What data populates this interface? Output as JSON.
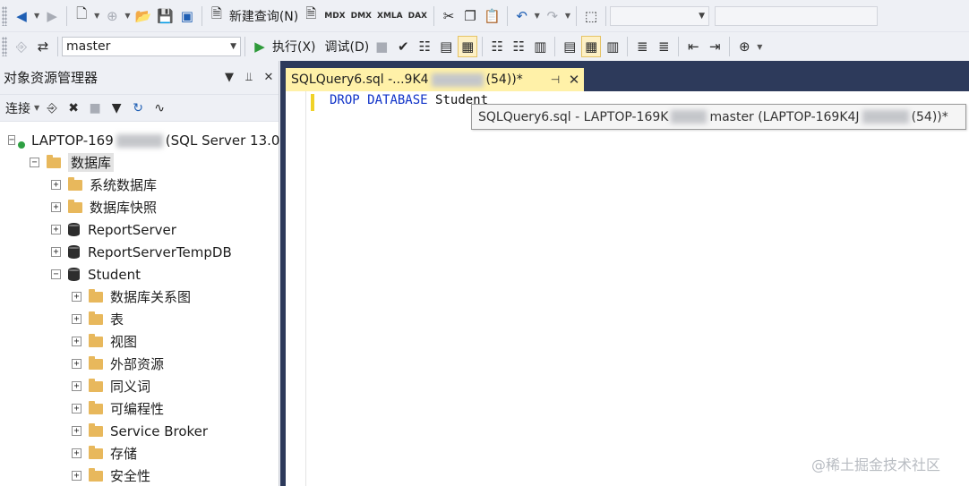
{
  "toolbar1": {
    "new_query_label": "新建查询(N)",
    "query_type_labels": [
      "MDX",
      "DMX",
      "XMLA",
      "DAX"
    ]
  },
  "toolbar2": {
    "database_select": "master",
    "execute_label": "执行(X)",
    "debug_label": "调试(D)"
  },
  "object_explorer": {
    "title": "对象资源管理器",
    "connect_label": "连接",
    "server_prefix": "LAPTOP-169",
    "server_suffix": "(SQL Server 13.0",
    "databases_label": "数据库",
    "items": [
      {
        "label": "系统数据库",
        "icon": "folder-icon"
      },
      {
        "label": "数据库快照",
        "icon": "folder-icon"
      },
      {
        "label": "ReportServer",
        "icon": "database-icon"
      },
      {
        "label": "ReportServerTempDB",
        "icon": "database-icon"
      },
      {
        "label": "Student",
        "icon": "database-icon"
      }
    ],
    "student_children": [
      "数据库关系图",
      "表",
      "视图",
      "外部资源",
      "同义词",
      "可编程性",
      "Service Broker",
      "存储",
      "安全性"
    ]
  },
  "editor": {
    "tab_prefix": "SQLQuery6.sql -...9K4",
    "tab_suffix": "(54))*",
    "code_keyword1": "DROP",
    "code_keyword2": "DATABASE",
    "code_ident": "Student",
    "tooltip_prefix": "SQLQuery6.sql - LAPTOP-169K",
    "tooltip_middle": "master (LAPTOP-169K4J",
    "tooltip_suffix": "(54))*"
  },
  "watermark": "@稀土掘金技术社区"
}
